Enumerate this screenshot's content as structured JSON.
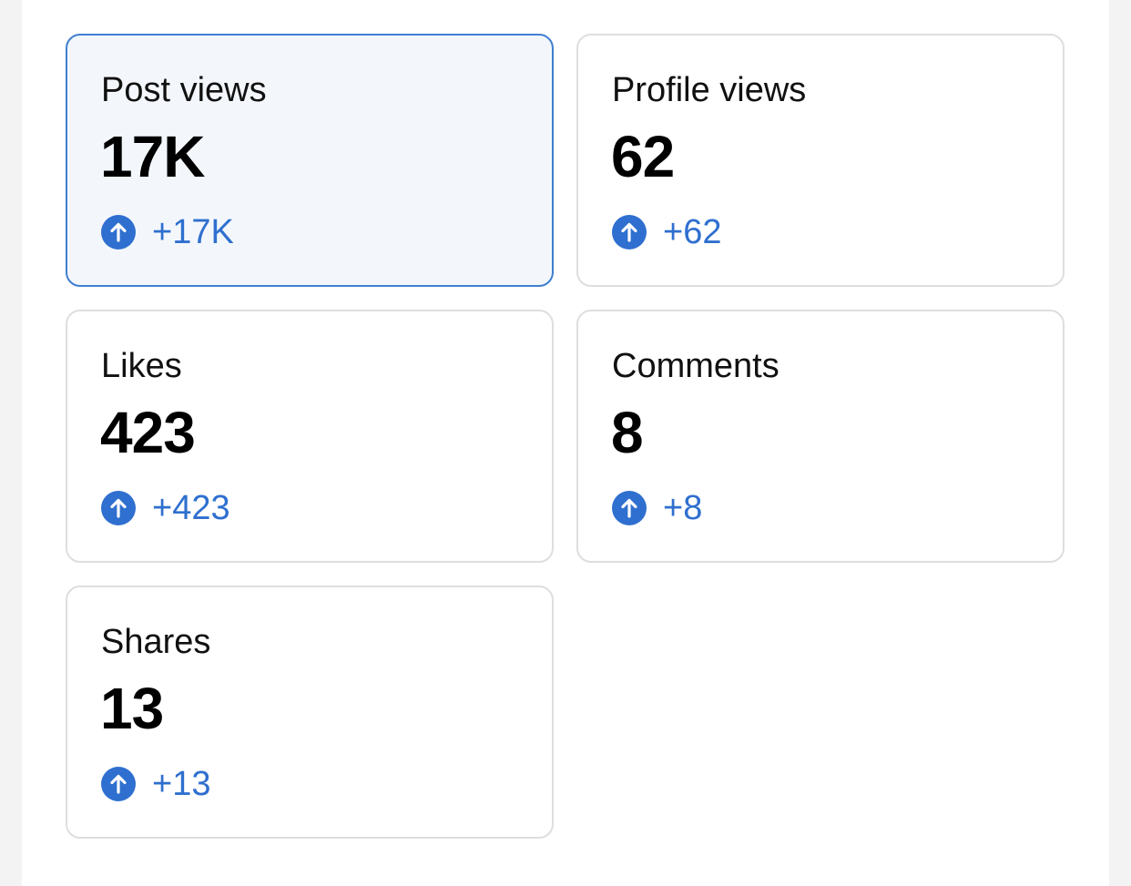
{
  "colors": {
    "accent": "#2f6fcf",
    "selected_border": "#3f7fcf",
    "selected_background": "#f3f7fc",
    "card_border": "#dedede"
  },
  "metrics": [
    {
      "label": "Post views",
      "value": "17K",
      "change": "+17K",
      "trend_icon": "arrow-up-circle-icon",
      "selected": true
    },
    {
      "label": "Profile views",
      "value": "62",
      "change": "+62",
      "trend_icon": "arrow-up-circle-icon",
      "selected": false
    },
    {
      "label": "Likes",
      "value": "423",
      "change": "+423",
      "trend_icon": "arrow-up-circle-icon",
      "selected": false
    },
    {
      "label": "Comments",
      "value": "8",
      "change": "+8",
      "trend_icon": "arrow-up-circle-icon",
      "selected": false
    },
    {
      "label": "Shares",
      "value": "13",
      "change": "+13",
      "trend_icon": "arrow-up-circle-icon",
      "selected": false
    }
  ]
}
